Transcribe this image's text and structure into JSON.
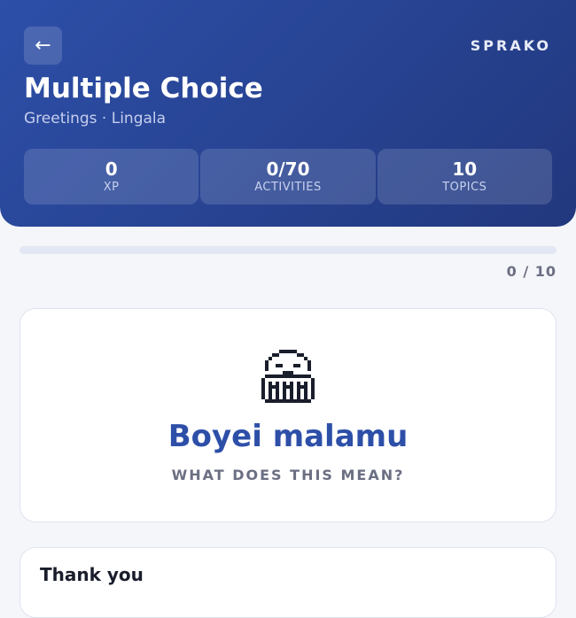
{
  "header": {
    "back_label": "←",
    "brand": "SPRAKO",
    "title": "Multiple Choice",
    "subtitle": "Greetings · Lingala",
    "stats": [
      {
        "value": "0",
        "label": "XP"
      },
      {
        "value": "0/70",
        "label": "ACTIVITIES"
      },
      {
        "value": "10",
        "label": "TOPICS"
      }
    ]
  },
  "progress": {
    "text": "0 / 10",
    "fraction": 0
  },
  "question": {
    "icon": "ghost-sprite-icon",
    "phrase": "Boyei malamu",
    "prompt": "WHAT DOES THIS MEAN?"
  },
  "options": [
    {
      "label": "Thank you"
    }
  ],
  "colors": {
    "accent": "#2d4fa8",
    "header_dark": "#22387e",
    "background": "#f5f6fa"
  }
}
